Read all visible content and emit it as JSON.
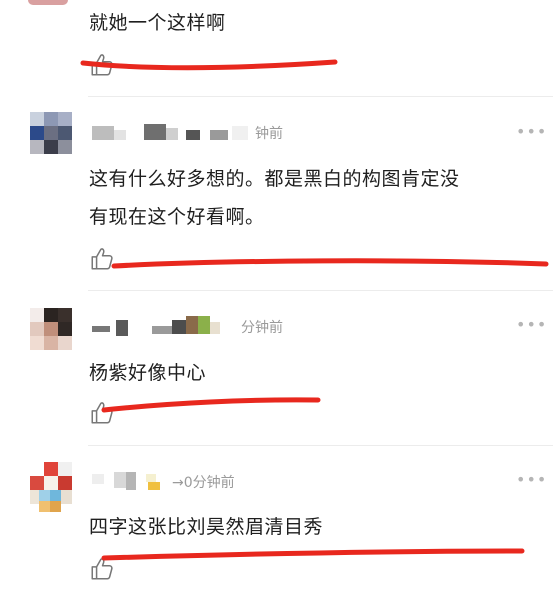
{
  "comments": [
    {
      "text": "就她一个这样啊"
    },
    {
      "time": "钟前",
      "lines": [
        "这有什么好多想的。都是黑白的构图肯定没",
        "有现在这个好看啊。"
      ]
    },
    {
      "time": "分钟前",
      "text": "杨紫好像中心"
    },
    {
      "time": "→0分钟前",
      "text": "四字这张比刘昊然眉清目秀"
    }
  ],
  "more_label": "•••",
  "colors": {
    "highlight": "#e8281e",
    "muted": "#9a9a9a",
    "divider": "#ececec"
  },
  "icons": {
    "like": "thumbs-up-icon",
    "more": "more-dots-icon"
  }
}
